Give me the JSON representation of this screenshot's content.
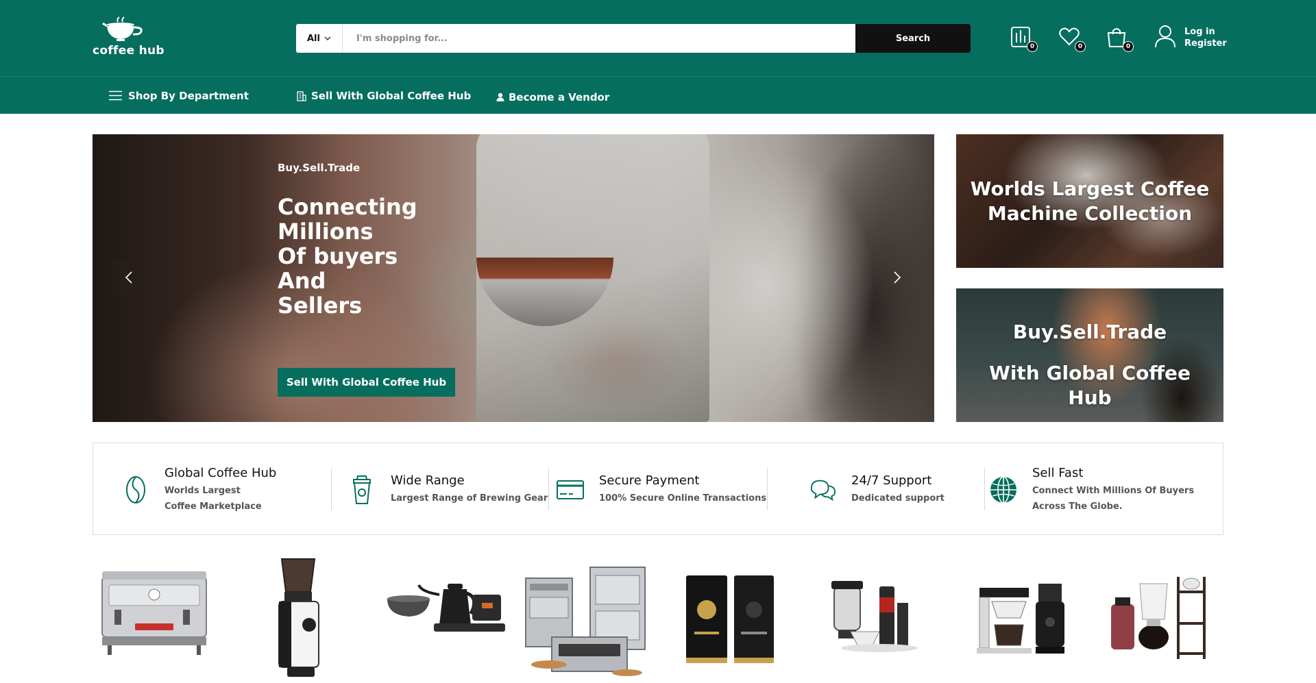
{
  "brand": {
    "name": "coffee hub"
  },
  "search": {
    "category": "All",
    "placeholder": "I'm shopping for...",
    "button": "Search"
  },
  "header_icons": [
    {
      "name": "compare-icon",
      "count": "0"
    },
    {
      "name": "heart-icon",
      "count": "0"
    },
    {
      "name": "cart-icon",
      "count": "0"
    }
  ],
  "account": {
    "login": "Log in",
    "register": "Register"
  },
  "nav": {
    "department": "Shop By Department",
    "sell": "Sell With Global Coffee Hub",
    "vendor": "Become a Vendor"
  },
  "hero": {
    "kicker": "Buy.Sell.Trade",
    "title": "Connecting\nMillions\nOf buyers\nAnd\nSellers",
    "cta": "Sell With Global Coffee Hub"
  },
  "promos": {
    "first": "Worlds Largest Coffee Machine Collection",
    "second_line1": "Buy.Sell.Trade",
    "second_line2": "With Global Coffee Hub"
  },
  "features": [
    {
      "title": "Global Coffee Hub",
      "desc": "Worlds Largest Coffee Marketplace",
      "icon": "coffee-bean-icon"
    },
    {
      "title": "Wide Range",
      "desc": "Largest Range of Brewing Gear",
      "icon": "coffee-cup-icon"
    },
    {
      "title": "Secure Payment",
      "desc": "100% Secure Online Transactions",
      "icon": "credit-card-icon"
    },
    {
      "title": "24/7 Support",
      "desc": "Dedicated support",
      "icon": "chat-icon"
    },
    {
      "title": "Sell Fast",
      "desc": "Connect With Millions Of Buyers Across The Globe.",
      "icon": "globe-icon"
    }
  ],
  "categories": [
    "espresso-machine",
    "coffee-grinder",
    "kettle-and-scale",
    "commercial-ovens",
    "coffee-bags",
    "brewing-equipment",
    "drip-brewer-and-grinder",
    "cold-brew-tower"
  ],
  "colors": {
    "brand_green": "#066e5e",
    "button_dark": "#111111"
  }
}
